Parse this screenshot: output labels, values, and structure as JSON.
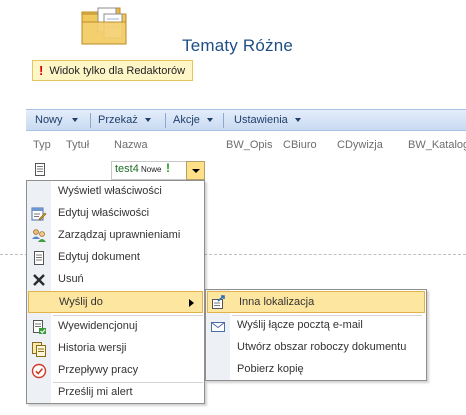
{
  "header": {
    "title": "Tematy Różne",
    "notice": "Widok tylko dla Redaktorów"
  },
  "toolbar": {
    "items": [
      {
        "label": "Nowy"
      },
      {
        "label": "Przekaż"
      },
      {
        "label": "Akcje"
      },
      {
        "label": "Ustawienia"
      }
    ]
  },
  "columns": [
    "Typ",
    "Tytuł",
    "Nazwa",
    "BW_Opis",
    "CBiuro",
    "CDywizja",
    "BW_Katalog"
  ],
  "row": {
    "name": "test4",
    "new_badge": "Nowe",
    "new_mark": "!"
  },
  "context_menu": {
    "items": [
      {
        "label": "Wyświetl właściwości",
        "icon": "none"
      },
      {
        "label": "Edytuj właściwości",
        "icon": "edit-properties-icon"
      },
      {
        "label": "Zarządzaj uprawnieniami",
        "icon": "permissions-icon"
      },
      {
        "label": "Edytuj dokument",
        "icon": "document-icon"
      },
      {
        "label": "Usuń",
        "icon": "delete-x-icon"
      },
      {
        "label": "Wyślij do",
        "icon": "none",
        "highlighted": true
      },
      {
        "label": "Wyewidencjonuj",
        "icon": "checkout-icon"
      },
      {
        "label": "Historia wersji",
        "icon": "version-history-icon"
      },
      {
        "label": "Przepływy pracy",
        "icon": "workflow-icon"
      },
      {
        "label": "Prześlij mi alert",
        "icon": "none"
      }
    ]
  },
  "send_to_menu": {
    "items": [
      {
        "label": "Inna lokalizacja",
        "icon": "other-location-icon",
        "highlighted": true
      },
      {
        "label": "Wyślij łącze pocztą e-mail",
        "icon": "email-link-icon"
      },
      {
        "label": "Utwórz obszar roboczy dokumentu",
        "icon": "none"
      },
      {
        "label": "Pobierz kopię",
        "icon": "none"
      }
    ]
  },
  "colors": {
    "title": "#1f4f82",
    "toolbar_bg": "#c9daf1",
    "highlight_bg": "#fde6a0",
    "highlight_border": "#e2b34b",
    "menu_gutter": "#edf0f4"
  }
}
